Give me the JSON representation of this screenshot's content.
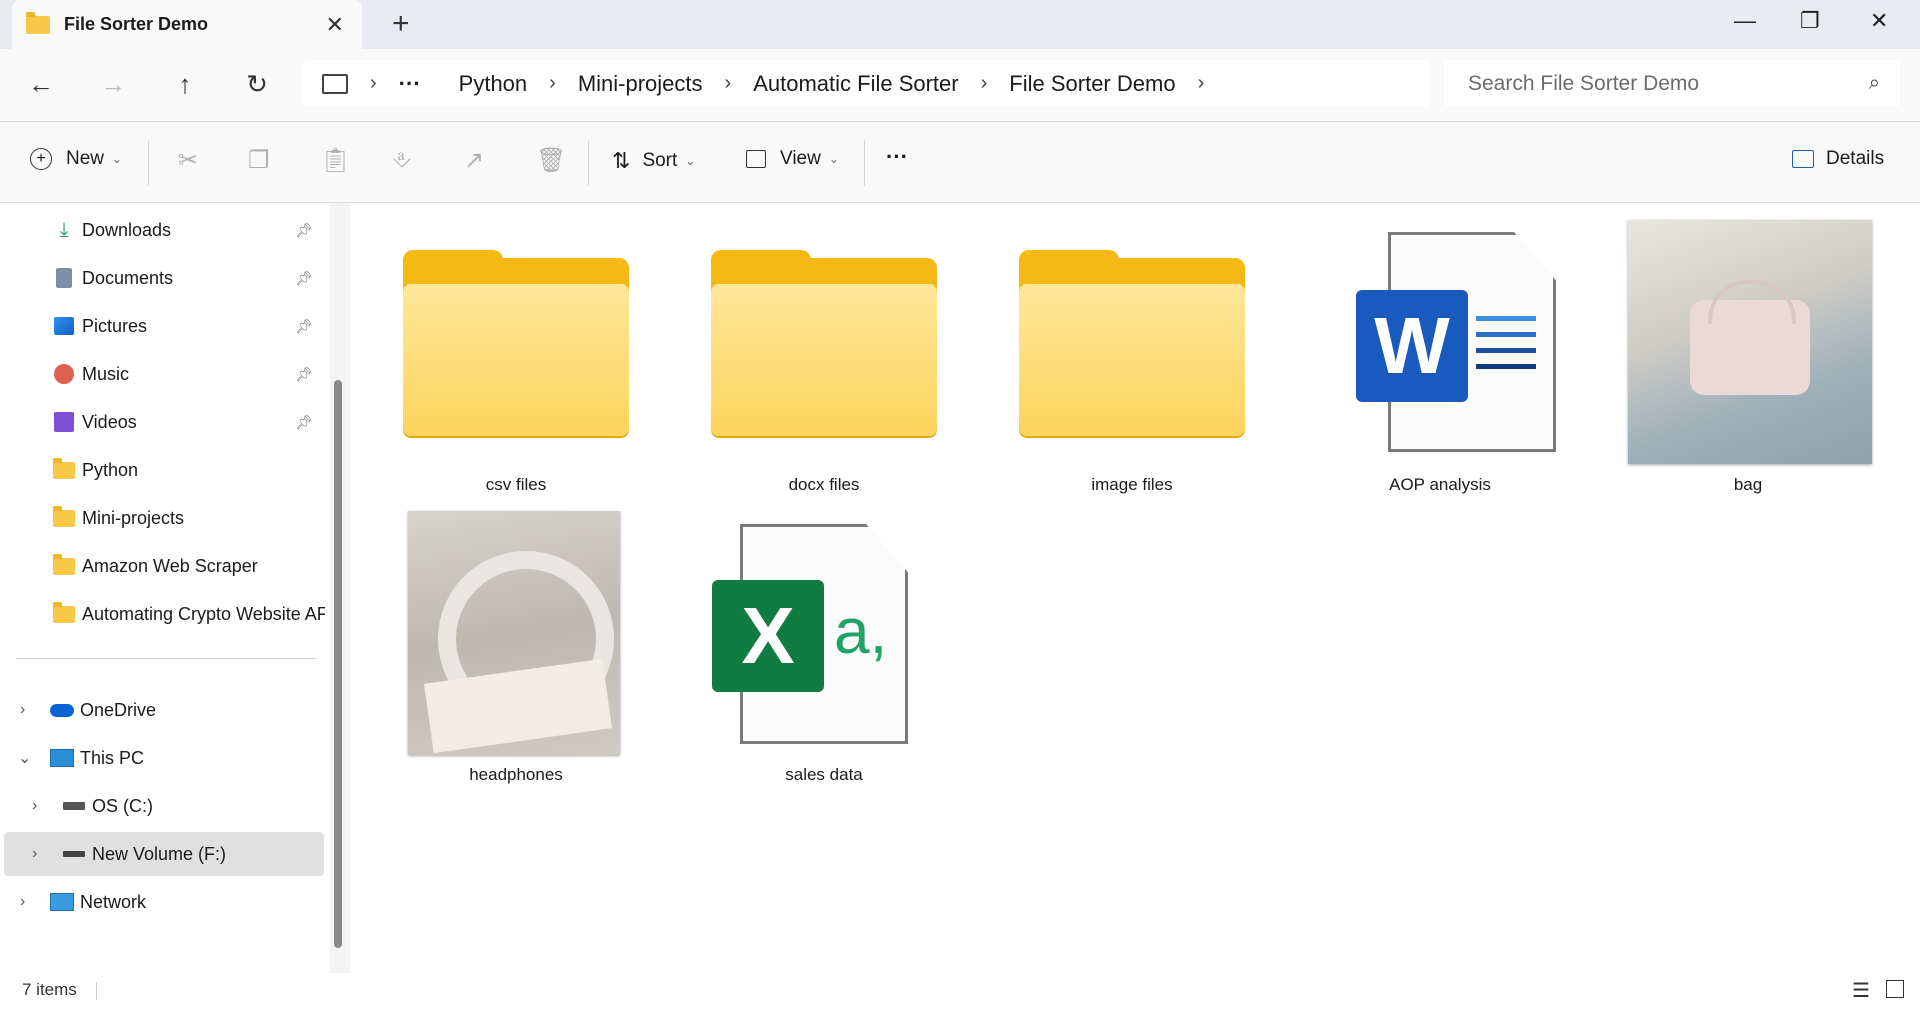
{
  "window": {
    "tab_title": "File Sorter Demo",
    "close_tab_glyph": "✕",
    "new_tab_glyph": "+",
    "minimize_glyph": "—",
    "restore_glyph": "❐",
    "close_glyph": "✕"
  },
  "nav": {
    "back_glyph": "←",
    "forward_glyph": "→",
    "up_glyph": "↑",
    "refresh_glyph": "↻"
  },
  "breadcrumb": {
    "root_icon": "this-pc-icon",
    "overflow": "···",
    "items": [
      "Python",
      "Mini-projects",
      "Automatic File Sorter",
      "File Sorter Demo"
    ]
  },
  "search": {
    "placeholder": "Search File Sorter Demo"
  },
  "commandbar": {
    "new_label": "New",
    "sort_label": "Sort",
    "view_label": "View",
    "more_label": "···",
    "details_label": "Details"
  },
  "sidebar": {
    "quick_access": [
      {
        "label": "Downloads",
        "icon": "download-icon"
      },
      {
        "label": "Documents",
        "icon": "documents-icon"
      },
      {
        "label": "Pictures",
        "icon": "pictures-icon"
      },
      {
        "label": "Music",
        "icon": "music-icon"
      },
      {
        "label": "Videos",
        "icon": "videos-icon"
      },
      {
        "label": "Python",
        "icon": "folder-icon"
      },
      {
        "label": "Mini-projects",
        "icon": "folder-icon"
      },
      {
        "label": "Amazon Web Scraper",
        "icon": "folder-icon"
      },
      {
        "label": "Automating Crypto Website AF",
        "icon": "folder-icon"
      }
    ],
    "locations": [
      {
        "label": "OneDrive",
        "icon": "onedrive-icon"
      },
      {
        "label": "This PC",
        "icon": "this-pc-icon"
      },
      {
        "label": "OS (C:)",
        "icon": "drive-icon"
      },
      {
        "label": "New Volume (F:)",
        "icon": "drive-icon"
      },
      {
        "label": "Network",
        "icon": "network-icon"
      }
    ]
  },
  "files": [
    {
      "name": "csv files",
      "type": "folder"
    },
    {
      "name": "docx files",
      "type": "folder"
    },
    {
      "name": "image files",
      "type": "folder"
    },
    {
      "name": "AOP analysis",
      "type": "word-document"
    },
    {
      "name": "bag",
      "type": "image"
    },
    {
      "name": "headphones",
      "type": "image"
    },
    {
      "name": "sales data",
      "type": "excel-csv"
    }
  ],
  "word_letter": "W",
  "excel_letter": "X",
  "excel_suffix": "a,",
  "status": {
    "item_count": "7 items"
  },
  "colors": {
    "folder": "#f5b915",
    "word": "#185abd",
    "excel": "#107c41",
    "selected_nav": "#e0e0e0"
  }
}
